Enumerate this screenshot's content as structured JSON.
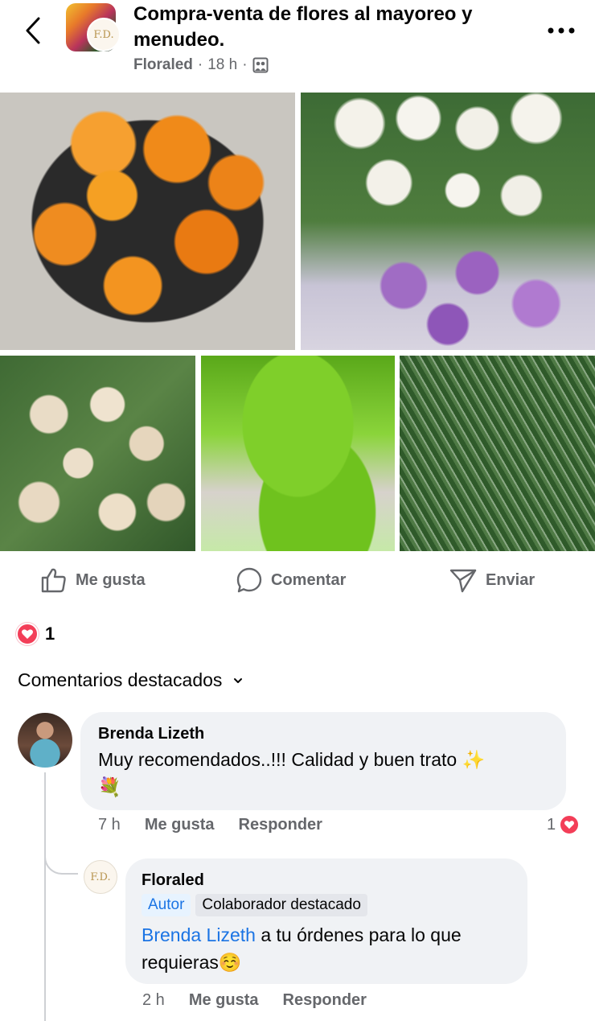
{
  "post": {
    "title": "Compra-venta de flores al mayoreo y menudeo.",
    "author": "Floraled",
    "separator": "·",
    "time": "18 h",
    "group_logo_text": "F.D."
  },
  "photos": [
    {
      "subject": "orange gerbera daisies"
    },
    {
      "subject": "white and lavender roses"
    },
    {
      "subject": "cream alstroemeria"
    },
    {
      "subject": "green dianthus"
    },
    {
      "subject": "green ruscus foliage"
    }
  ],
  "actions": {
    "like": "Me gusta",
    "comment": "Comentar",
    "send": "Enviar"
  },
  "reactions": {
    "count": "1",
    "type": "love"
  },
  "comments_section": {
    "label": "Comentarios destacados"
  },
  "comments": [
    {
      "author": "Brenda Lizeth",
      "text": "Muy recomendados..!!! Calidad y buen trato ✨",
      "emoji_line": "💐",
      "time": "7 h",
      "like_label": "Me gusta",
      "reply_label": "Responder",
      "reaction_count": "1"
    }
  ],
  "reply": {
    "author": "Floraled",
    "badge_author": "Autor",
    "badge_collab": "Colaborador destacado",
    "mention": "Brenda Lizeth",
    "text": " a tu órdenes para lo que requieras",
    "emoji": "☺️",
    "avatar_text": "F.D.",
    "time": "2 h",
    "like_label": "Me gusta",
    "reply_label": "Responder"
  },
  "colors": {
    "accent": "#1b74e4",
    "love": "#f33e58",
    "secondary_text": "#65676b",
    "bubble": "#f0f2f5"
  }
}
